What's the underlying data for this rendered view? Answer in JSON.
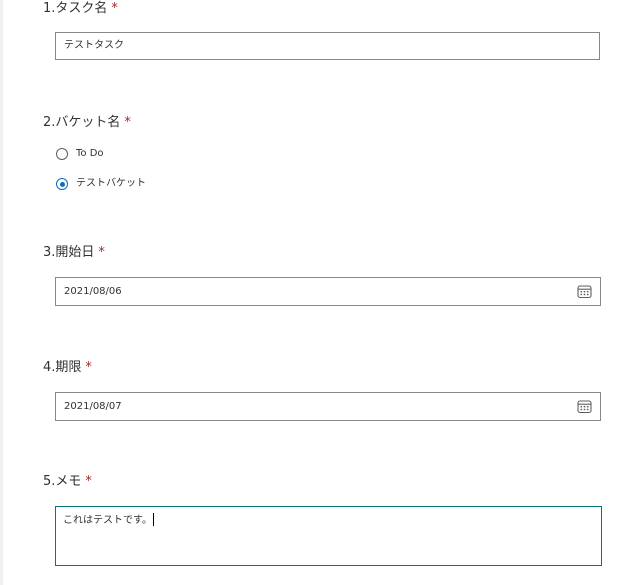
{
  "form": {
    "required_mark": "*",
    "questions": [
      {
        "number": "1.",
        "title": "タスク名",
        "type": "text",
        "value": "テストタスク"
      },
      {
        "number": "2.",
        "title": "バケット名",
        "type": "choice",
        "options": [
          {
            "label": "To Do",
            "checked": false
          },
          {
            "label": "テストバケット",
            "checked": true
          }
        ]
      },
      {
        "number": "3.",
        "title": "開始日",
        "type": "date",
        "value": "2021/08/06",
        "icon": "calendar-icon"
      },
      {
        "number": "4.",
        "title": "期限",
        "type": "date",
        "value": "2021/08/07",
        "icon": "calendar-icon"
      },
      {
        "number": "5.",
        "title": "メモ",
        "type": "long-text",
        "value": "これはテストです。"
      }
    ]
  },
  "colors": {
    "required": "#a4262c",
    "radio_selected": "#0f6cbd",
    "focused_border": "#03787c",
    "input_border": "#8a8886"
  }
}
